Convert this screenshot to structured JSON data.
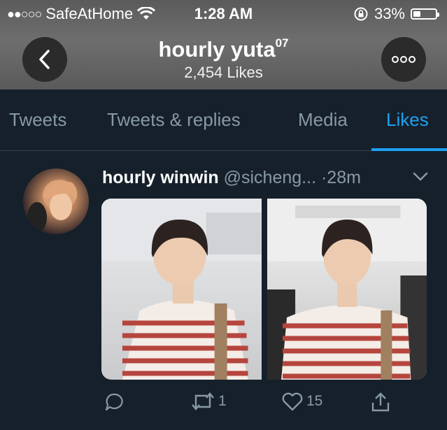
{
  "status_bar": {
    "signal": "●●○○○",
    "carrier": "SafeAtHome",
    "time": "1:28 AM",
    "battery_percent": "33%",
    "battery_level": 0.33
  },
  "nav": {
    "title": "hourly yuta",
    "title_superscript": "07",
    "subtitle": "2,454 Likes"
  },
  "tabs": [
    {
      "label": "Tweets",
      "active": false
    },
    {
      "label": "Tweets & replies",
      "active": false
    },
    {
      "label": "Media",
      "active": false
    },
    {
      "label": "Likes",
      "active": true
    }
  ],
  "tweet": {
    "display_name": "hourly winwin",
    "handle": "@sicheng...",
    "separator": "·",
    "time": "28m",
    "reply_count": "",
    "retweet_count": "1",
    "like_count": "15"
  },
  "colors": {
    "background": "#15202b",
    "accent": "#1da1f2",
    "muted": "#8899a6",
    "divider": "#38444d"
  }
}
